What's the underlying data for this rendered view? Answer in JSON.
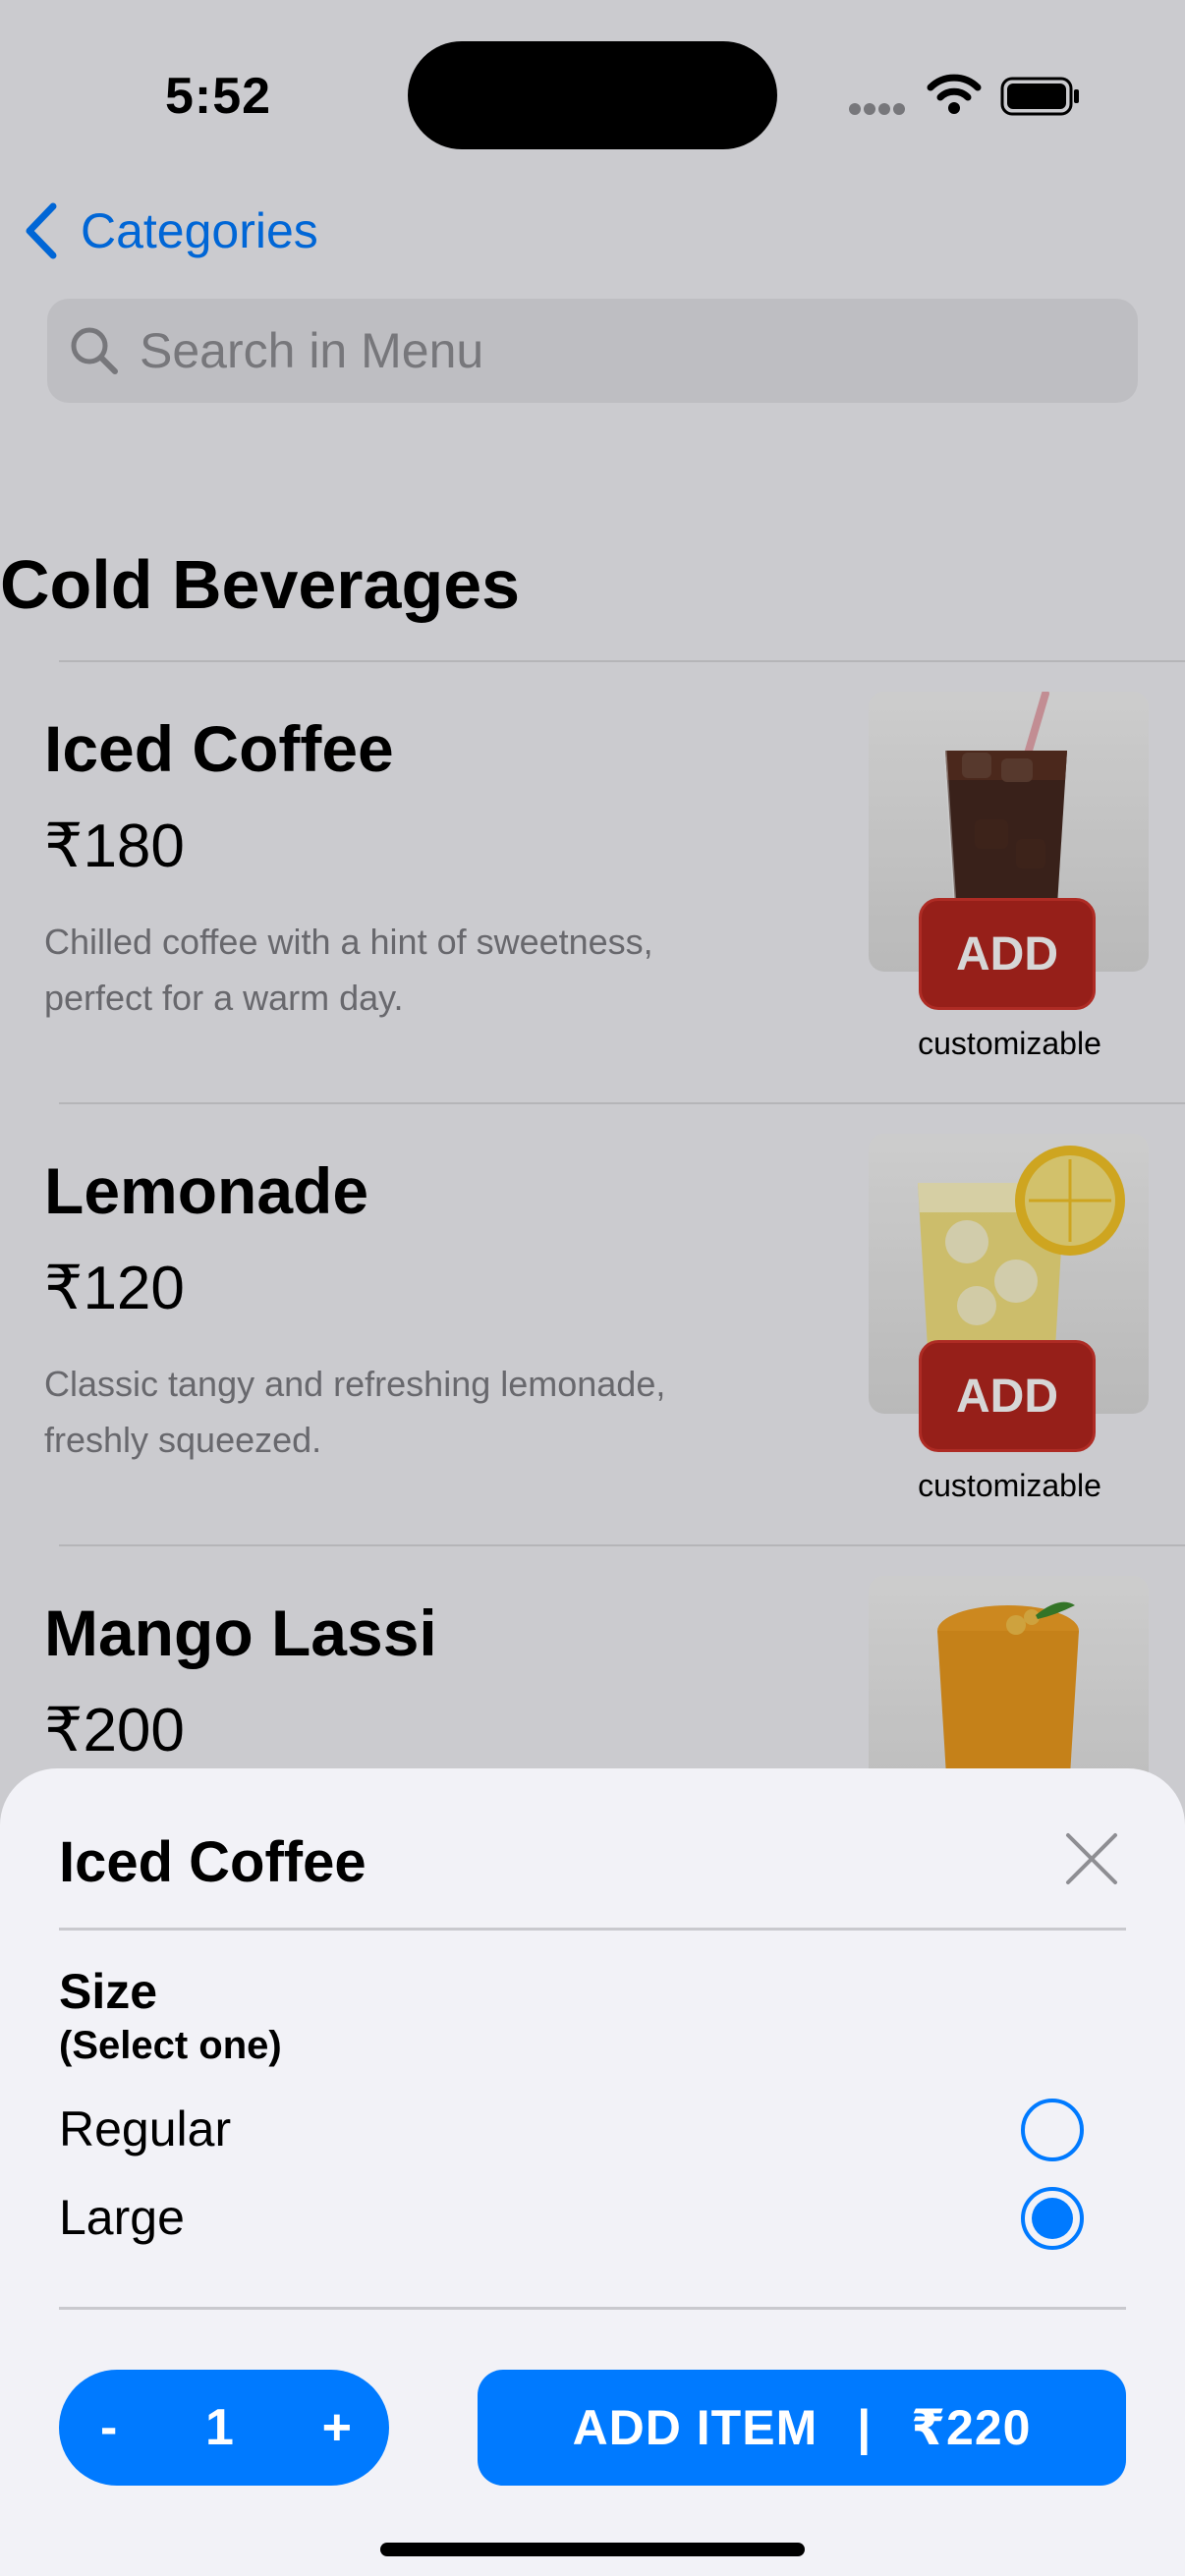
{
  "status_bar": {
    "time": "5:52"
  },
  "nav": {
    "back_label": "Categories"
  },
  "search": {
    "placeholder": "Search in Menu"
  },
  "section": {
    "title": "Cold Beverages"
  },
  "menu_items": [
    {
      "name": "Iced Coffee",
      "price": "₹180",
      "description": "Chilled coffee with a hint of sweetness, perfect for a warm day.",
      "add_label": "ADD",
      "tag": "customizable"
    },
    {
      "name": "Lemonade",
      "price": "₹120",
      "description": "Classic tangy and refreshing lemonade, freshly squeezed.",
      "add_label": "ADD",
      "tag": "customizable"
    },
    {
      "name": "Mango Lassi",
      "price": "₹200"
    }
  ],
  "sheet": {
    "title": "Iced Coffee",
    "group_title": "Size",
    "group_subtitle": "(Select one)",
    "options": [
      {
        "label": "Regular",
        "selected": false
      },
      {
        "label": "Large",
        "selected": true
      }
    ],
    "stepper": {
      "minus": "-",
      "quantity": "1",
      "plus": "+"
    },
    "add_button": {
      "label": "ADD ITEM",
      "separator": "|",
      "price": "₹220"
    }
  },
  "colors": {
    "accent": "#007aff",
    "add_button": "#b3261e",
    "background": "#f2f2f7"
  },
  "icons": {
    "back": "chevron-left-icon",
    "search": "search-icon",
    "close": "close-icon",
    "wifi": "wifi-icon",
    "battery": "battery-icon",
    "signal": "signal-icon"
  }
}
